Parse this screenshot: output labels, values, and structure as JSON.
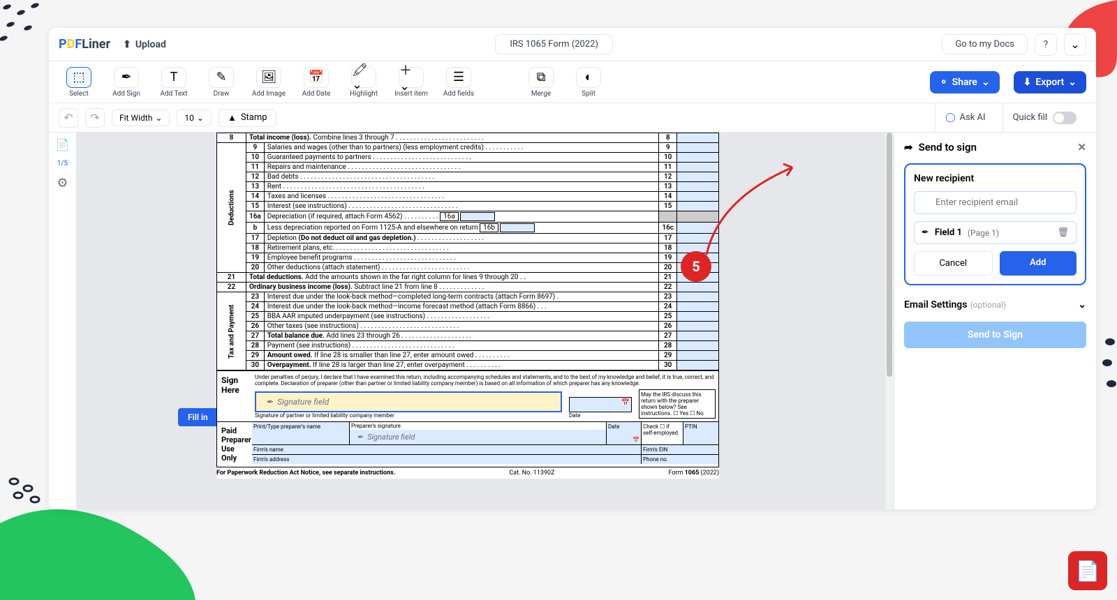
{
  "header": {
    "logo_text": "PDFLiner",
    "upload_label": "Upload",
    "doc_title": "IRS 1065 Form (2022)",
    "goto_docs": "Go to my Docs",
    "help": "?"
  },
  "toolbar": {
    "select": "Select",
    "add_sign": "Add Sign",
    "add_text": "Add Text",
    "draw": "Draw",
    "add_image": "Add Image",
    "add_date": "Add Date",
    "highlight": "Highlight",
    "insert_item": "Insert item",
    "add_fields": "Add fields",
    "merge": "Merge",
    "split": "Split",
    "share": "Share",
    "export": "Export"
  },
  "subbar": {
    "fit_width": "Fit Width",
    "zoom": "10",
    "stamp": "Stamp",
    "ask_ai": "Ask AI",
    "quick_fill": "Quick fill"
  },
  "leftbar": {
    "page_ind": "1/5"
  },
  "fillin": "Fill in",
  "callout_num": "5",
  "send_panel": {
    "title": "Send to sign",
    "new_recipient": "New recipient",
    "email_placeholder": "Enter recipient email",
    "field_name": "Field 1",
    "field_page": "(Page 1)",
    "cancel": "Cancel",
    "add": "Add",
    "email_settings": "Email Settings",
    "optional": "(optional)",
    "send_to_sign": "Send to Sign"
  },
  "form": {
    "rows": [
      {
        "n": "8",
        "t": "Total income (loss). Combine lines 3 through 7",
        "bold": true
      },
      {
        "n": "9",
        "t": "Salaries and wages (other than to partners) (less employment credits)"
      },
      {
        "n": "10",
        "t": "Guaranteed payments to partners"
      },
      {
        "n": "11",
        "t": "Repairs and maintenance"
      },
      {
        "n": "12",
        "t": "Bad debts"
      },
      {
        "n": "13",
        "t": "Rent"
      },
      {
        "n": "14",
        "t": "Taxes and licenses"
      },
      {
        "n": "15",
        "t": "Interest (see instructions)"
      },
      {
        "n": "16a",
        "t": "Depreciation (if required, attach Form 4562)"
      },
      {
        "n": "b",
        "t": "Less depreciation reported on Form 1125-A and elsewhere on return"
      },
      {
        "n": "17",
        "t": "Depletion (Do not deduct oil and gas depletion.)",
        "bold_part": true
      },
      {
        "n": "18",
        "t": "Retirement plans, etc."
      },
      {
        "n": "19",
        "t": "Employee benefit programs"
      },
      {
        "n": "20",
        "t": "Other deductions (attach statement)"
      },
      {
        "n": "21",
        "t": "Total deductions. Add the amounts shown in the far right column for lines 9 through 20",
        "bold": true
      },
      {
        "n": "22",
        "t": "Ordinary business income (loss). Subtract line 21 from line 8",
        "bold": true
      },
      {
        "n": "23",
        "t": "Interest due under the look-back method—completed long-term contracts (attach Form 8697)"
      },
      {
        "n": "24",
        "t": "Interest due under the look-back method—income forecast method (attach Form 8866)"
      },
      {
        "n": "25",
        "t": "BBA AAR imputed underpayment (see instructions)"
      },
      {
        "n": "26",
        "t": "Other taxes (see instructions)"
      },
      {
        "n": "27",
        "t": "Total balance due. Add lines 23 through 26",
        "bold": true
      },
      {
        "n": "28",
        "t": "Payment (see instructions)"
      },
      {
        "n": "29",
        "t": "Amount owed. If line 28 is smaller than line 27, enter amount owed",
        "bold": true
      },
      {
        "n": "30",
        "t": "Overpayment. If line 28 is larger than line 27, enter overpayment",
        "bold": true
      }
    ],
    "deductions_label": "Deductions",
    "tax_label": "Tax and Payment",
    "sign_here": "Sign Here",
    "sig_field": "Signature field",
    "sig_caption": "Signature of partner or limited liability company member",
    "date_lbl": "Date",
    "irs_box": "May the IRS discuss this return with the preparer shown below? See instructions.",
    "yes": "Yes",
    "no": "No",
    "perjury": "Under penalties of perjury, I declare that I have examined this return, including accompanying schedules and statements, and to the best of my knowledge and belief, it is true, correct, and complete. Declaration of preparer (other than partner or limited liability company member) is based on all information of which preparer has any knowledge.",
    "paid_prep": "Paid Preparer Use Only",
    "print_type": "Print/Type preparer's name",
    "prep_sig": "Preparer's signature",
    "check_self": "Check ☐ if self-employed",
    "ptin": "PTIN",
    "firms_name": "Firm's name",
    "firms_addr": "Firm's address",
    "firms_ein": "Firm's EIN",
    "phone": "Phone no.",
    "paperwork": "For Paperwork Reduction Act Notice, see separate instructions.",
    "catno": "Cat. No. 11390Z",
    "form_footer": "Form 1065 (2022)"
  }
}
